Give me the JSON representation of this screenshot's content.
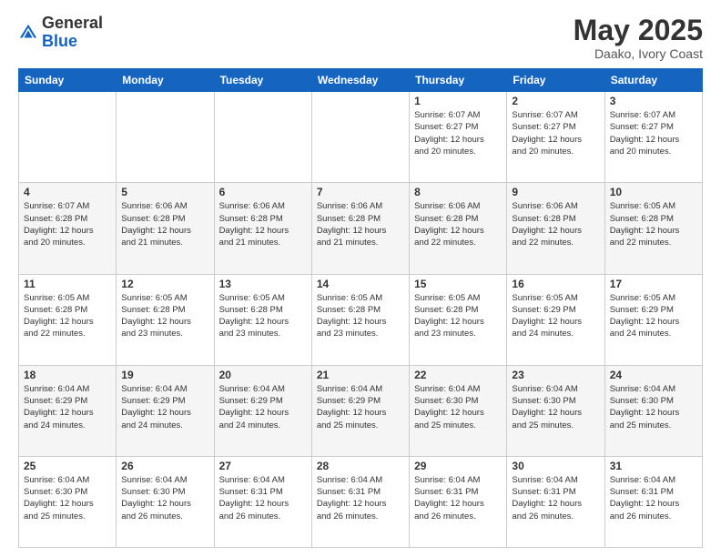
{
  "header": {
    "logo_general": "General",
    "logo_blue": "Blue",
    "title": "May 2025",
    "subtitle": "Daako, Ivory Coast"
  },
  "weekdays": [
    "Sunday",
    "Monday",
    "Tuesday",
    "Wednesday",
    "Thursday",
    "Friday",
    "Saturday"
  ],
  "weeks": [
    [
      {
        "day": "",
        "info": ""
      },
      {
        "day": "",
        "info": ""
      },
      {
        "day": "",
        "info": ""
      },
      {
        "day": "",
        "info": ""
      },
      {
        "day": "1",
        "info": "Sunrise: 6:07 AM\nSunset: 6:27 PM\nDaylight: 12 hours\nand 20 minutes."
      },
      {
        "day": "2",
        "info": "Sunrise: 6:07 AM\nSunset: 6:27 PM\nDaylight: 12 hours\nand 20 minutes."
      },
      {
        "day": "3",
        "info": "Sunrise: 6:07 AM\nSunset: 6:27 PM\nDaylight: 12 hours\nand 20 minutes."
      }
    ],
    [
      {
        "day": "4",
        "info": "Sunrise: 6:07 AM\nSunset: 6:28 PM\nDaylight: 12 hours\nand 20 minutes."
      },
      {
        "day": "5",
        "info": "Sunrise: 6:06 AM\nSunset: 6:28 PM\nDaylight: 12 hours\nand 21 minutes."
      },
      {
        "day": "6",
        "info": "Sunrise: 6:06 AM\nSunset: 6:28 PM\nDaylight: 12 hours\nand 21 minutes."
      },
      {
        "day": "7",
        "info": "Sunrise: 6:06 AM\nSunset: 6:28 PM\nDaylight: 12 hours\nand 21 minutes."
      },
      {
        "day": "8",
        "info": "Sunrise: 6:06 AM\nSunset: 6:28 PM\nDaylight: 12 hours\nand 22 minutes."
      },
      {
        "day": "9",
        "info": "Sunrise: 6:06 AM\nSunset: 6:28 PM\nDaylight: 12 hours\nand 22 minutes."
      },
      {
        "day": "10",
        "info": "Sunrise: 6:05 AM\nSunset: 6:28 PM\nDaylight: 12 hours\nand 22 minutes."
      }
    ],
    [
      {
        "day": "11",
        "info": "Sunrise: 6:05 AM\nSunset: 6:28 PM\nDaylight: 12 hours\nand 22 minutes."
      },
      {
        "day": "12",
        "info": "Sunrise: 6:05 AM\nSunset: 6:28 PM\nDaylight: 12 hours\nand 23 minutes."
      },
      {
        "day": "13",
        "info": "Sunrise: 6:05 AM\nSunset: 6:28 PM\nDaylight: 12 hours\nand 23 minutes."
      },
      {
        "day": "14",
        "info": "Sunrise: 6:05 AM\nSunset: 6:28 PM\nDaylight: 12 hours\nand 23 minutes."
      },
      {
        "day": "15",
        "info": "Sunrise: 6:05 AM\nSunset: 6:28 PM\nDaylight: 12 hours\nand 23 minutes."
      },
      {
        "day": "16",
        "info": "Sunrise: 6:05 AM\nSunset: 6:29 PM\nDaylight: 12 hours\nand 24 minutes."
      },
      {
        "day": "17",
        "info": "Sunrise: 6:05 AM\nSunset: 6:29 PM\nDaylight: 12 hours\nand 24 minutes."
      }
    ],
    [
      {
        "day": "18",
        "info": "Sunrise: 6:04 AM\nSunset: 6:29 PM\nDaylight: 12 hours\nand 24 minutes."
      },
      {
        "day": "19",
        "info": "Sunrise: 6:04 AM\nSunset: 6:29 PM\nDaylight: 12 hours\nand 24 minutes."
      },
      {
        "day": "20",
        "info": "Sunrise: 6:04 AM\nSunset: 6:29 PM\nDaylight: 12 hours\nand 24 minutes."
      },
      {
        "day": "21",
        "info": "Sunrise: 6:04 AM\nSunset: 6:29 PM\nDaylight: 12 hours\nand 25 minutes."
      },
      {
        "day": "22",
        "info": "Sunrise: 6:04 AM\nSunset: 6:30 PM\nDaylight: 12 hours\nand 25 minutes."
      },
      {
        "day": "23",
        "info": "Sunrise: 6:04 AM\nSunset: 6:30 PM\nDaylight: 12 hours\nand 25 minutes."
      },
      {
        "day": "24",
        "info": "Sunrise: 6:04 AM\nSunset: 6:30 PM\nDaylight: 12 hours\nand 25 minutes."
      }
    ],
    [
      {
        "day": "25",
        "info": "Sunrise: 6:04 AM\nSunset: 6:30 PM\nDaylight: 12 hours\nand 25 minutes."
      },
      {
        "day": "26",
        "info": "Sunrise: 6:04 AM\nSunset: 6:30 PM\nDaylight: 12 hours\nand 26 minutes."
      },
      {
        "day": "27",
        "info": "Sunrise: 6:04 AM\nSunset: 6:31 PM\nDaylight: 12 hours\nand 26 minutes."
      },
      {
        "day": "28",
        "info": "Sunrise: 6:04 AM\nSunset: 6:31 PM\nDaylight: 12 hours\nand 26 minutes."
      },
      {
        "day": "29",
        "info": "Sunrise: 6:04 AM\nSunset: 6:31 PM\nDaylight: 12 hours\nand 26 minutes."
      },
      {
        "day": "30",
        "info": "Sunrise: 6:04 AM\nSunset: 6:31 PM\nDaylight: 12 hours\nand 26 minutes."
      },
      {
        "day": "31",
        "info": "Sunrise: 6:04 AM\nSunset: 6:31 PM\nDaylight: 12 hours\nand 26 minutes."
      }
    ]
  ]
}
